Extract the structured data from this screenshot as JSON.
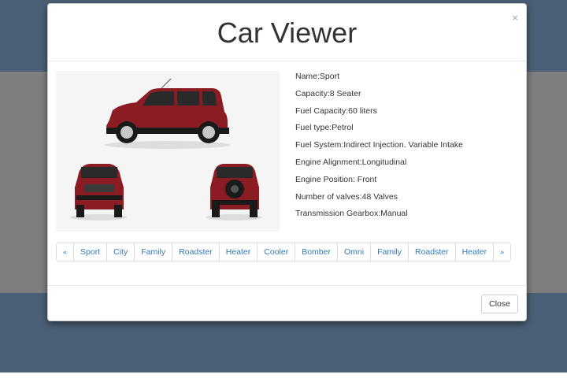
{
  "modal": {
    "title": "Car Viewer",
    "close_icon": "×",
    "close_button": "Close"
  },
  "car": {
    "image_icon": "car-photo",
    "body_color": "#8b1c24",
    "specs": [
      "Name:Sport",
      "Capacity:8 Seater",
      "Fuel Capacity:60 liters",
      "Fuel type:Petrol",
      "Fuel System:Indirect Injection. Variable Intake",
      "Engine Alignment:Longitudinal",
      "Engine Position: Front",
      "Number of valves:48 Valves",
      "Transmission Gearbox:Manual"
    ]
  },
  "pagination": {
    "prev": "«",
    "next": "»",
    "items": [
      "Sport",
      "City",
      "Family",
      "Roadster",
      "Heater",
      "Cooler",
      "Bomber",
      "Omni",
      "Family",
      "Roadster",
      "Heater"
    ]
  },
  "colors": {
    "backdrop_dark": "#4b5f76",
    "backdrop_gray": "#7f7f7f",
    "link": "#337ab7"
  }
}
